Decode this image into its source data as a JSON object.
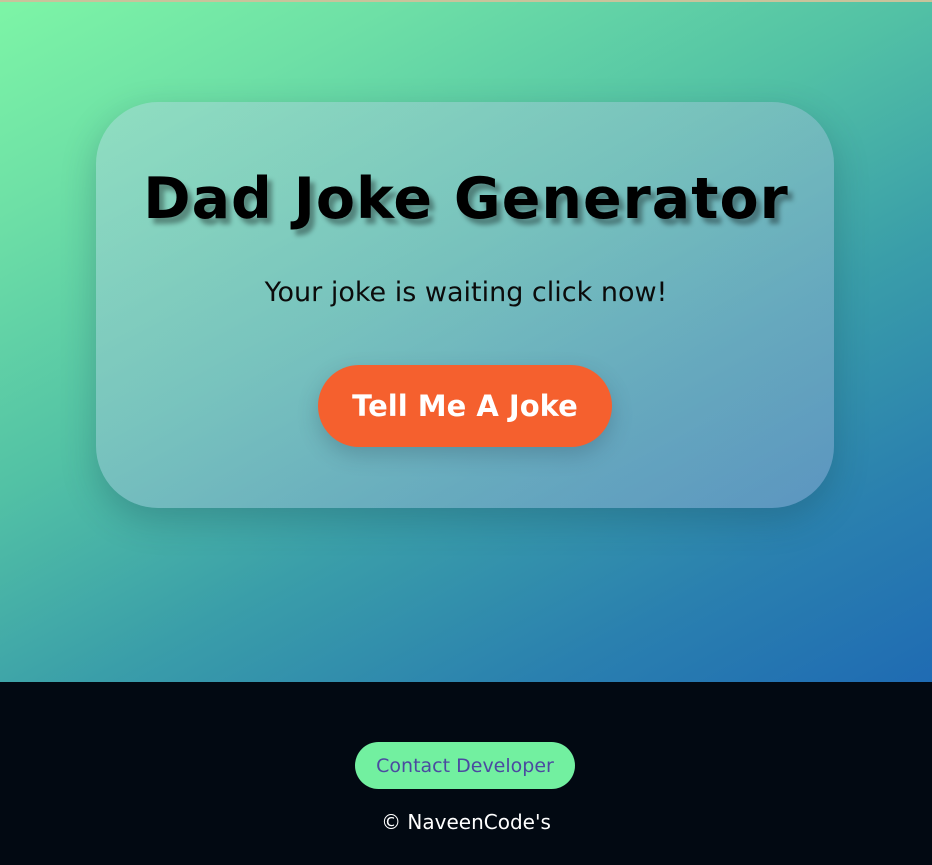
{
  "hero": {
    "title": "Dad Joke Generator",
    "joke_text": "Your joke is waiting click now!",
    "button_label": "Tell Me A Joke"
  },
  "footer": {
    "contact_label": "Contact Developer",
    "copyright": "© NaveenCode's"
  },
  "colors": {
    "gradient_start": "#7df5a6",
    "gradient_end": "#1f6bb3",
    "button_accent": "#f5602e",
    "footer_bg": "#020912",
    "contact_button_bg": "#72f0a0",
    "contact_button_text": "#4b4aa0"
  }
}
